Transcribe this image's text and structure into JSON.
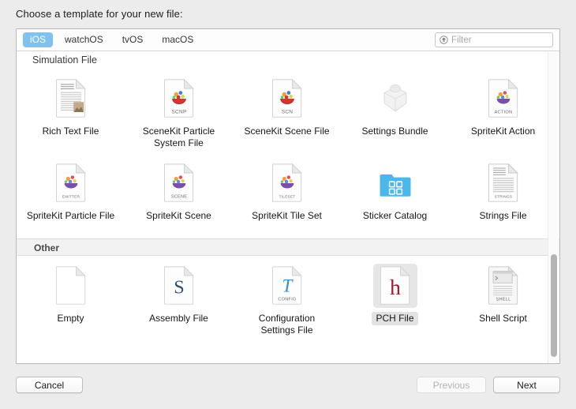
{
  "dialog": {
    "prompt": "Choose a template for your new file:"
  },
  "platform_tabs": [
    {
      "label": "iOS",
      "selected": true
    },
    {
      "label": "watchOS",
      "selected": false
    },
    {
      "label": "tvOS",
      "selected": false
    },
    {
      "label": "macOS",
      "selected": false
    }
  ],
  "filter": {
    "value": "",
    "placeholder": "Filter",
    "icon": "search-circle-icon"
  },
  "sections": [
    {
      "header": "Simulation File",
      "header_style": "plain",
      "templates": [
        {
          "label": "Rich Text File",
          "icon": "rich-text-file-icon",
          "badge": "",
          "selected": false
        },
        {
          "label": "SceneKit Particle System File",
          "icon": "scenekit-particle-icon",
          "badge": "SCNP",
          "selected": false
        },
        {
          "label": "SceneKit Scene File",
          "icon": "scenekit-scene-icon",
          "badge": "SCN",
          "selected": false
        },
        {
          "label": "Settings Bundle",
          "icon": "settings-bundle-icon",
          "badge": "",
          "selected": false
        },
        {
          "label": "SpriteKit Action",
          "icon": "spritekit-action-icon",
          "badge": "ACTION",
          "selected": false
        },
        {
          "label": "SpriteKit Particle File",
          "icon": "spritekit-particle-icon",
          "badge": "EMITTER",
          "selected": false
        },
        {
          "label": "SpriteKit Scene",
          "icon": "spritekit-scene-icon",
          "badge": "SCENE",
          "selected": false
        },
        {
          "label": "SpriteKit Tile Set",
          "icon": "spritekit-tileset-icon",
          "badge": "TILESET",
          "selected": false
        },
        {
          "label": "Sticker Catalog",
          "icon": "sticker-catalog-icon",
          "badge": "",
          "selected": false
        },
        {
          "label": "Strings File",
          "icon": "strings-file-icon",
          "badge": "STRINGS",
          "selected": false
        }
      ]
    },
    {
      "header": "Other",
      "header_style": "band",
      "templates": [
        {
          "label": "Empty",
          "icon": "empty-file-icon",
          "badge": "",
          "selected": false
        },
        {
          "label": "Assembly File",
          "icon": "assembly-file-icon",
          "badge": "",
          "selected": false
        },
        {
          "label": "Configuration Settings File",
          "icon": "configuration-settings-icon",
          "badge": "CONFIG",
          "selected": false
        },
        {
          "label": "PCH File",
          "icon": "pch-file-icon",
          "badge": "",
          "selected": true
        },
        {
          "label": "Shell Script",
          "icon": "shell-script-icon",
          "badge": "SHELL",
          "selected": false
        }
      ]
    }
  ],
  "footer": {
    "cancel": "Cancel",
    "previous": "Previous",
    "next": "Next",
    "previous_disabled": true
  },
  "scrollbar": {
    "thumb_top_pct": 65,
    "thumb_height_pct": 33
  },
  "colors": {
    "selected_tab": "#7fc2f2",
    "selection_highlight": "#e6e6e6",
    "window_background": "#ececec",
    "panel_background": "#ffffff"
  }
}
